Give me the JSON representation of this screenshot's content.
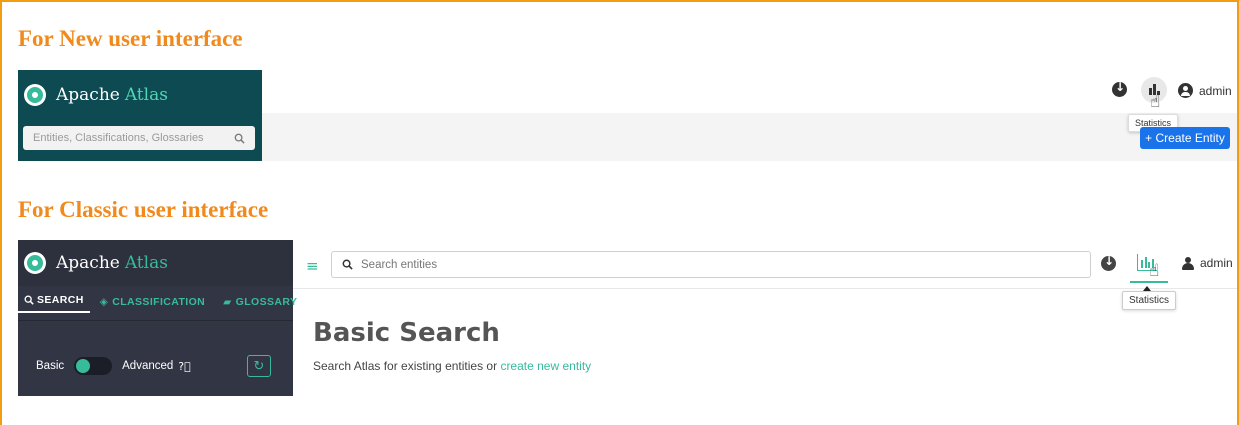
{
  "headings": {
    "new_ui": "For New user interface",
    "classic_ui": "For Classic user interface"
  },
  "new_ui": {
    "brand": {
      "name": "Apache",
      "accent": "Atlas"
    },
    "search": {
      "placeholder": "Entities, Classifications, Glossaries"
    },
    "user": "admin",
    "tooltip": "Statistics",
    "create_button": "+ Create Entity",
    "colors": {
      "sidebar": "#0d4a52",
      "accent": "#4fd6b4",
      "button": "#1a73e8"
    }
  },
  "classic_ui": {
    "brand": {
      "name": "Apache",
      "accent": "Atlas"
    },
    "tabs": [
      {
        "label": "SEARCH",
        "icon": "search-icon"
      },
      {
        "label": "CLASSIFICATION",
        "icon": "tag-icon"
      },
      {
        "label": "GLOSSARY",
        "icon": "folder-icon"
      }
    ],
    "toggle": {
      "left": "Basic",
      "right": "Advanced"
    },
    "search": {
      "placeholder": "Search entities"
    },
    "user": "admin",
    "tooltip": "Statistics",
    "main": {
      "title": "Basic Search",
      "subtitle": "Search Atlas for existing entities or",
      "link": "create new entity"
    },
    "colors": {
      "sidebar": "#323544",
      "accent": "#37bb9b"
    }
  }
}
